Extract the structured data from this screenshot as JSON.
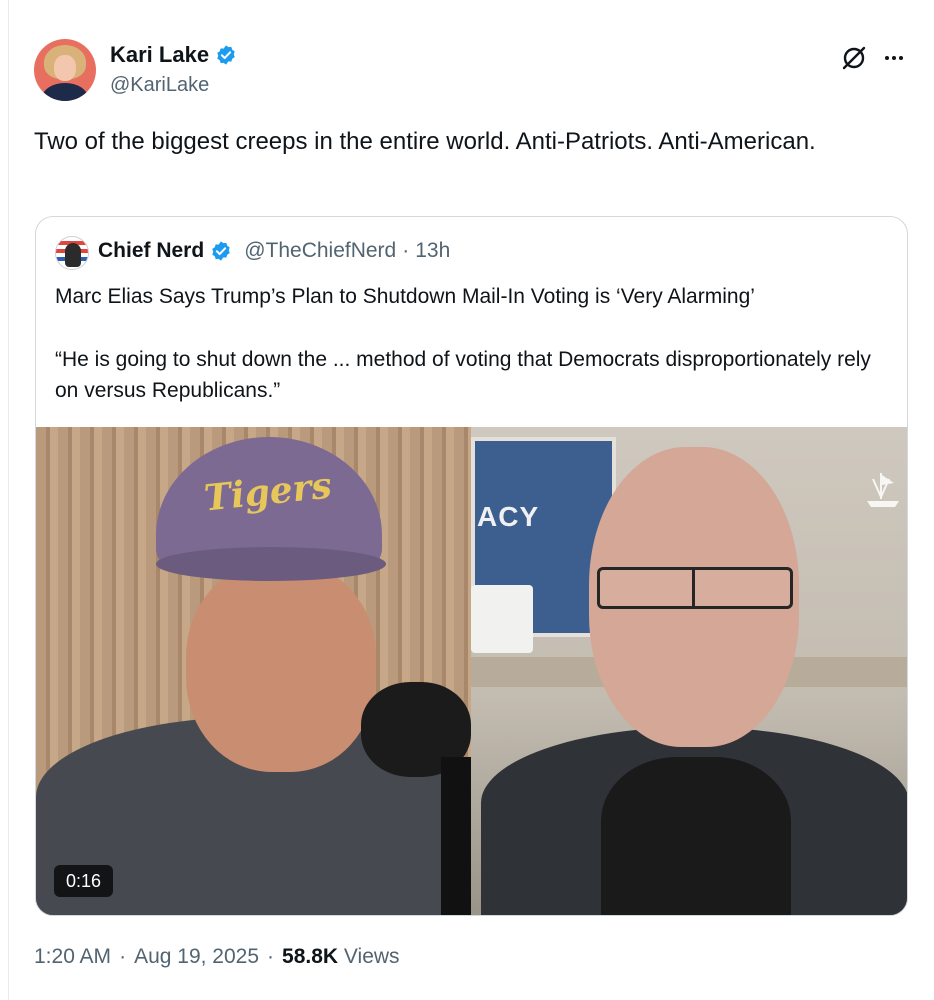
{
  "author": {
    "display_name": "Kari Lake",
    "handle": "@KariLake",
    "avatar_icon": "avatar-photo",
    "verified_icon": "verified-badge-icon",
    "verified_color": "#1d9bf0"
  },
  "actions": {
    "grok_icon": "grok-icon",
    "more_icon": "more-options-icon"
  },
  "tweet_text": "Two of the biggest creeps in the entire world.  Anti-Patriots. Anti-American.",
  "quoted_tweet": {
    "display_name": "Chief Nerd",
    "handle": "@TheChiefNerd",
    "separator": "·",
    "time": "13h",
    "headline": "Marc Elias Says Trump’s Plan to Shutdown Mail-In Voting is ‘Very Alarming’",
    "quote": "“He is going to shut down the ... method of voting that Democrats disproportionately rely on versus Republicans.”",
    "video": {
      "duration": "0:16",
      "cap_text": "Tigers",
      "poster_text": "ACY"
    }
  },
  "meta": {
    "time": "1:20 AM",
    "separator": "·",
    "date": "Aug 19, 2025",
    "views_count": "58.8K",
    "views_label": "Views"
  }
}
